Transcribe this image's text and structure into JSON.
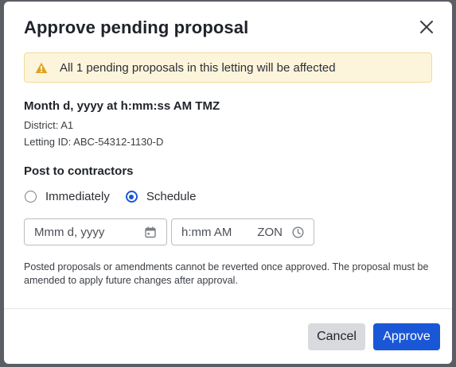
{
  "dialog": {
    "title": "Approve pending proposal",
    "close_label": "close"
  },
  "alert": {
    "icon": "warning-icon",
    "color": "#e0a321",
    "text": "All 1 pending proposals in this letting will be affected"
  },
  "letting": {
    "datetime": "Month d, yyyy at h:mm:ss AM TMZ",
    "district": "District: A1",
    "letting_id": "Letting ID: ABC-54312-1130-D"
  },
  "post_to_contractors": {
    "label": "Post to contractors",
    "options": [
      {
        "label": "Immediately",
        "selected": false
      },
      {
        "label": "Schedule",
        "selected": true
      }
    ],
    "date_input": {
      "placeholder": "Mmm d, yyyy",
      "icon": "calendar-icon"
    },
    "time_input": {
      "placeholder": "h:mm AM",
      "zone": "ZON",
      "icon": "clock-icon"
    }
  },
  "help_text": "Posted proposals or amendments cannot be reverted once approved. The proposal must be amended to apply future changes after approval.",
  "footer": {
    "cancel_label": "Cancel",
    "approve_label": "Approve"
  },
  "colors": {
    "primary": "#1a57d6",
    "alert_bg": "#fdf4dc",
    "alert_border": "#f2dd99"
  }
}
